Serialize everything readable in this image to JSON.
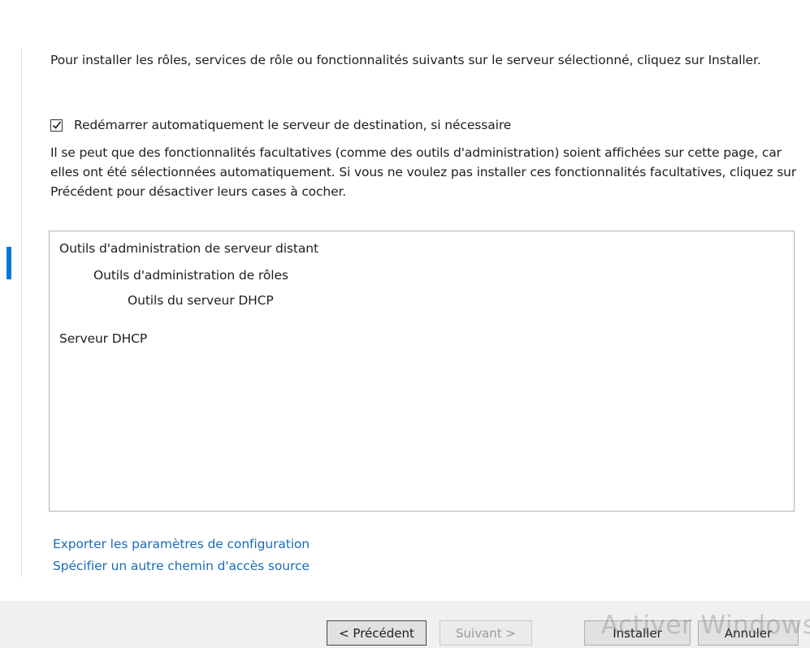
{
  "intro_text": "Pour installer les rôles, services de rôle ou fonctionnalités suivants sur le serveur sélectionné, cliquez sur Installer.",
  "restart": {
    "label": "Redémarrer automatiquement le serveur de destination, si nécessaire",
    "checked": true
  },
  "note_text": "Il se peut que des fonctionnalités facultatives (comme des outils d'administration) soient affichées sur cette page, car elles ont été sélectionnées automatiquement. Si vous ne voulez pas installer ces fonctionnalités facultatives, cliquez sur Précédent pour désactiver leurs cases à cocher.",
  "features": [
    "Outils d'administration de serveur distant",
    "Outils d'administration de rôles",
    "Outils du serveur DHCP",
    "Serveur DHCP"
  ],
  "links": {
    "export": "Exporter les paramètres de configuration",
    "source_path": "Spécifier un autre chemin d'accès source"
  },
  "buttons": {
    "previous": "< Précédent",
    "next": "Suivant >",
    "install": "Installer",
    "cancel": "Annuler"
  },
  "watermark": "Activer Windows",
  "colors": {
    "accent": "#0078d7",
    "link": "#1c6bb8"
  }
}
